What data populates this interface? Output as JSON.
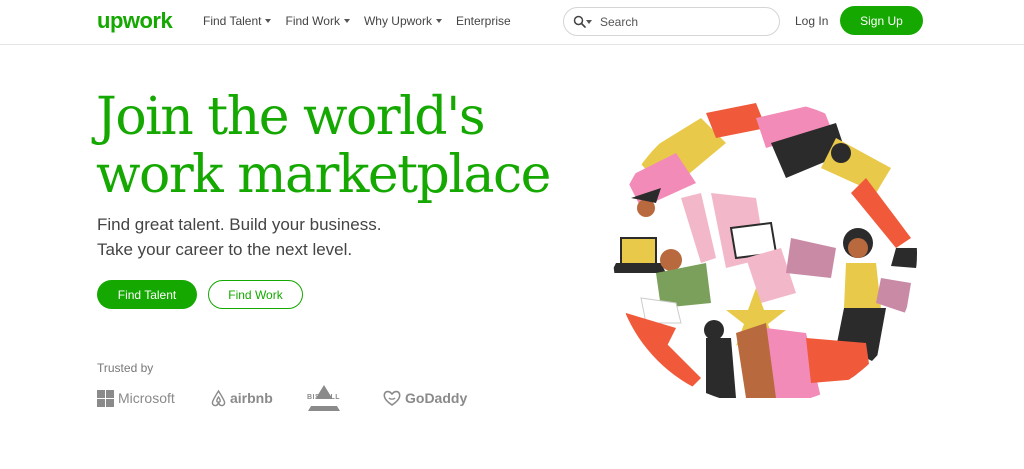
{
  "header": {
    "logo": "upwork",
    "nav": [
      {
        "label": "Find Talent",
        "dropdown": true
      },
      {
        "label": "Find Work",
        "dropdown": true
      },
      {
        "label": "Why Upwork",
        "dropdown": true
      },
      {
        "label": "Enterprise",
        "dropdown": false
      }
    ],
    "search": {
      "placeholder": "Search",
      "icon": "search-icon"
    },
    "login": "Log In",
    "signup": "Sign Up"
  },
  "hero": {
    "headline_line1": "Join the world's",
    "headline_line2": "work marketplace",
    "subtitle_line1": "Find great talent. Build your business.",
    "subtitle_line2": "Take your career to the next level.",
    "primary_button": "Find Talent",
    "secondary_button": "Find Work"
  },
  "trusted": {
    "label": "Trusted by",
    "brands": [
      "Microsoft",
      "airbnb",
      "BISSELL",
      "GoDaddy"
    ]
  },
  "colors": {
    "brand_green": "#14a800",
    "text_dark": "#444444",
    "brand_gray": "#8a8a8a"
  }
}
